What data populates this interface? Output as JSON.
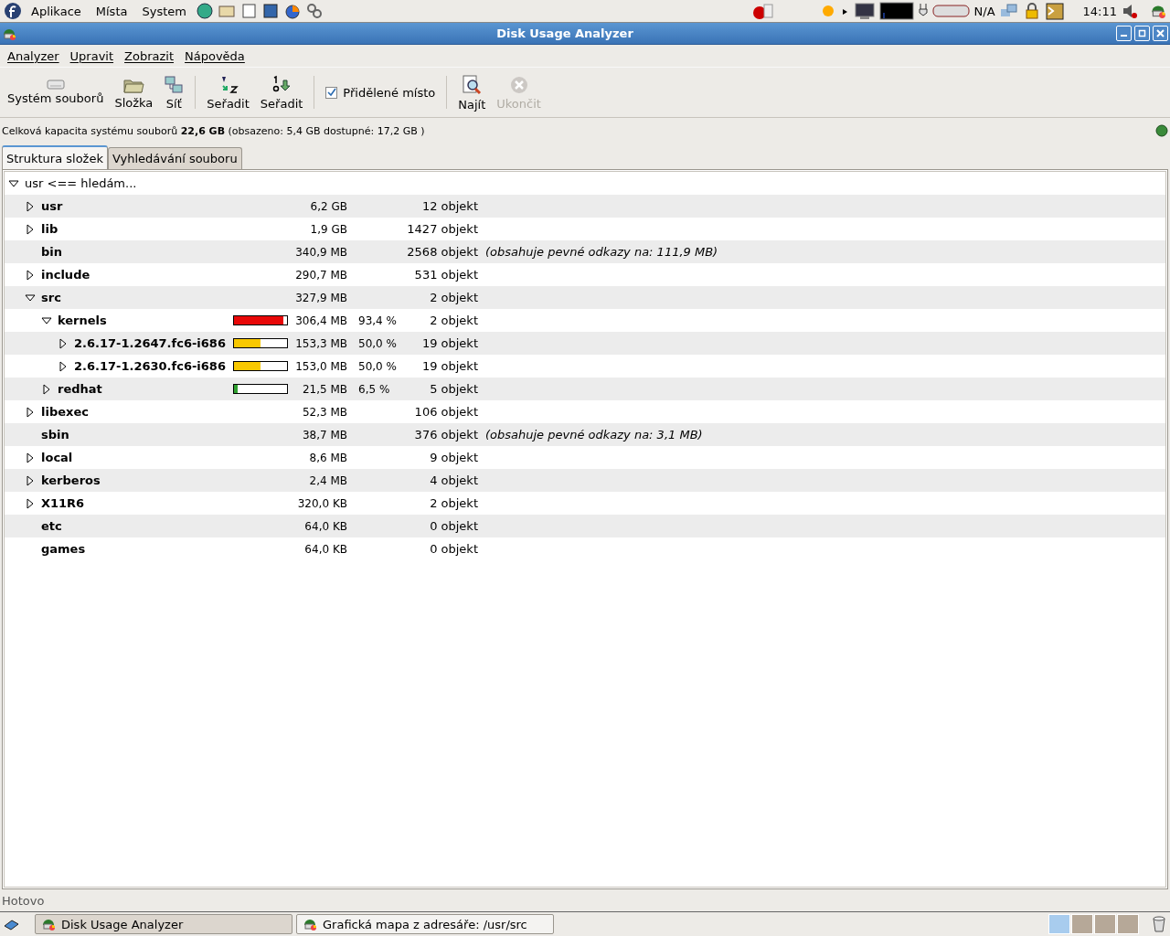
{
  "top_panel": {
    "menus": [
      "Aplikace",
      "Místa",
      "System"
    ],
    "battery_reading": "N/A",
    "clock": "14:11"
  },
  "window": {
    "title": "Disk Usage Analyzer"
  },
  "menubar": [
    "Analyzer",
    "Upravit",
    "Zobrazit",
    "Nápověda"
  ],
  "toolbar": [
    {
      "kind": "button",
      "label": "Systém souborů",
      "disabled": false
    },
    {
      "kind": "button",
      "label": "Složka",
      "disabled": false
    },
    {
      "kind": "button",
      "label": "Síť",
      "disabled": false
    },
    {
      "kind": "separator"
    },
    {
      "kind": "button",
      "label": "Seřadit",
      "disabled": false
    },
    {
      "kind": "button",
      "label": "Seřadit",
      "disabled": false
    },
    {
      "kind": "separator"
    },
    {
      "kind": "checkbox",
      "label": "Přidělené místo",
      "checked": true
    },
    {
      "kind": "separator"
    },
    {
      "kind": "button",
      "label": "Najít",
      "disabled": false
    },
    {
      "kind": "button",
      "label": "Ukončit",
      "disabled": true
    }
  ],
  "capacity": "Celková kapacita systému souborů **22,6 GB** (obsazeno: 5,4 GB dostupné: 17,2 GB )",
  "tabs": [
    {
      "label": "Struktura složek",
      "selected": true
    },
    {
      "label": "Vyhledávání souboru",
      "selected": false
    }
  ],
  "tree": {
    "name": "usr <== hledám...",
    "expander": true,
    "expanded": true,
    "children": [
      {
        "name": "usr",
        "expander": true,
        "expanded": false,
        "size": "6,2 GB",
        "count": "12 objekt"
      },
      {
        "name": "lib",
        "expander": true,
        "expanded": false,
        "size": "1,9 GB",
        "count": "1427 objekt"
      },
      {
        "name": "bin",
        "expander": false,
        "size": "340,9 MB",
        "count": "2568 objekt",
        "note": "(obsahuje pevné odkazy na: 111,9 MB)"
      },
      {
        "name": "include",
        "expander": true,
        "expanded": false,
        "size": "290,7 MB",
        "count": "531 objekt"
      },
      {
        "name": "src",
        "expander": true,
        "expanded": true,
        "size": "327,9 MB",
        "count": "2 objekt",
        "children": [
          {
            "name": "kernels",
            "expander": true,
            "expanded": true,
            "level": 0.934,
            "size": "306,4 MB",
            "percent": "93,4 %",
            "count": "2 objekt",
            "children": [
              {
                "name": "2.6.17-1.2647.fc6-i686",
                "expander": true,
                "expanded": false,
                "level": 0.5,
                "size": "153,3 MB",
                "percent": "50,0 %",
                "count": "19 objekt"
              },
              {
                "name": "2.6.17-1.2630.fc6-i686",
                "expander": true,
                "expanded": false,
                "level": 0.5,
                "size": "153,0 MB",
                "percent": "50,0 %",
                "count": "19 objekt"
              }
            ]
          },
          {
            "name": "redhat",
            "expander": true,
            "expanded": false,
            "level": 0.065,
            "size": "21,5 MB",
            "percent": "6,5 %",
            "count": "5 objekt"
          }
        ]
      },
      {
        "name": "libexec",
        "expander": true,
        "expanded": false,
        "size": "52,3 MB",
        "count": "106 objekt"
      },
      {
        "name": "sbin",
        "expander": false,
        "size": "38,7 MB",
        "count": "376 objekt",
        "note": "(obsahuje pevné odkazy na: 3,1 MB)"
      },
      {
        "name": "local",
        "expander": true,
        "expanded": false,
        "size": "8,6 MB",
        "count": "9 objekt"
      },
      {
        "name": "kerberos",
        "expander": true,
        "expanded": false,
        "size": "2,4 MB",
        "count": "4 objekt"
      },
      {
        "name": "X11R6",
        "expander": true,
        "expanded": false,
        "size": "320,0 KB",
        "count": "2 objekt"
      },
      {
        "name": "etc",
        "expander": false,
        "size": "64,0 KB",
        "count": "0 objekt"
      },
      {
        "name": "games",
        "expander": false,
        "size": "64,0 KB",
        "count": "0 objekt"
      }
    ]
  },
  "status_bar": "Hotovo",
  "taskbar": [
    {
      "label": "Disk Usage Analyzer",
      "selected": true
    },
    {
      "label": "Grafická mapa z adresáře: /usr/src",
      "selected": false
    }
  ],
  "workspaces": [
    {
      "selected": true
    },
    {
      "selected": false
    },
    {
      "selected": false
    },
    {
      "selected": false
    }
  ]
}
